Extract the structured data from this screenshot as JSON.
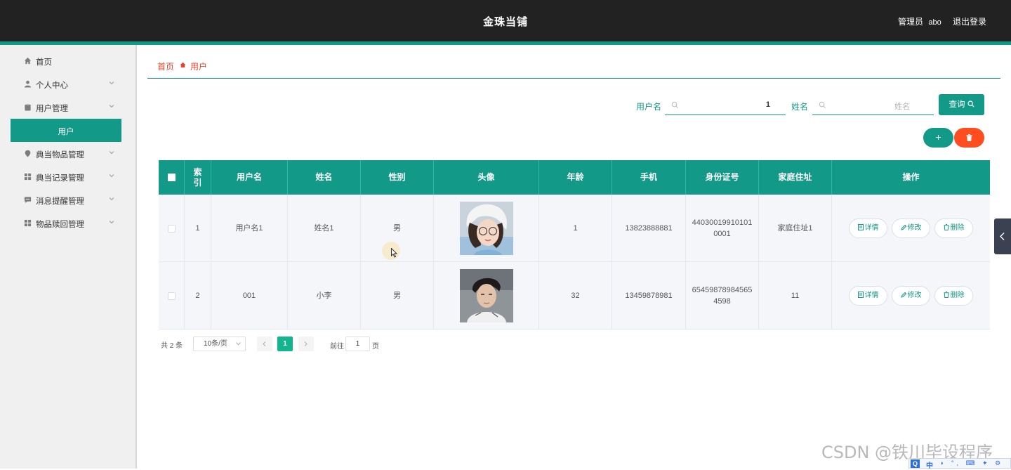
{
  "header": {
    "app_title": "金珠当铺",
    "role_label": "管理员",
    "username": "abo",
    "logout_label": "退出登录"
  },
  "sidebar": {
    "items": [
      {
        "label": "首页",
        "icon": "home-icon"
      },
      {
        "label": "个人中心",
        "icon": "user-icon"
      },
      {
        "label": "用户管理",
        "icon": "clipboard-icon"
      },
      {
        "label": "用户",
        "icon": ""
      },
      {
        "label": "典当物品管理",
        "icon": "location-icon"
      },
      {
        "label": "典当记录管理",
        "icon": "grid-icon"
      },
      {
        "label": "消息提醒管理",
        "icon": "message-icon"
      },
      {
        "label": "物品赎回管理",
        "icon": "grid-icon"
      }
    ]
  },
  "breadcrumb": {
    "home": "首页",
    "current": "用户"
  },
  "search": {
    "username_label": "用户名",
    "username_value": "1",
    "name_label": "姓名",
    "name_placeholder": "姓名",
    "query_label": "查询"
  },
  "actions": {
    "add_symbol": "+"
  },
  "table": {
    "columns": [
      "索引",
      "用户名",
      "姓名",
      "性别",
      "头像",
      "年龄",
      "手机",
      "身份证号",
      "家庭住址",
      "操作"
    ],
    "rows": [
      {
        "index": "1",
        "username": "用户名1",
        "name": "姓名1",
        "gender": "男",
        "age": "1",
        "phone": "13823888881",
        "id_number": "440300199101010001",
        "address": "家庭住址1"
      },
      {
        "index": "2",
        "username": "001",
        "name": "小李",
        "gender": "男",
        "age": "32",
        "phone": "13459878981",
        "id_number": "654598789845654598",
        "address": "11"
      }
    ],
    "op_detail": "详情",
    "op_edit": "修改",
    "op_delete": "删除"
  },
  "pagination": {
    "total_prefix": "共",
    "total": "2",
    "total_suffix": "条",
    "page_size": "10条/页",
    "current_page": "1",
    "goto_label": "前往",
    "goto_value": "1",
    "page_suffix": "页"
  },
  "overlay": {
    "watermark": "CSDN @铁川毕设程序",
    "ime_q": "Q",
    "ime_mode": "中",
    "ime_rest": "◗ °, ⌨ ✦ ⚙"
  },
  "colors": {
    "primary": "#129987",
    "danger": "#ff4d1f",
    "header_bg": "#222222",
    "breadcrumb_red": "#e8442d"
  }
}
